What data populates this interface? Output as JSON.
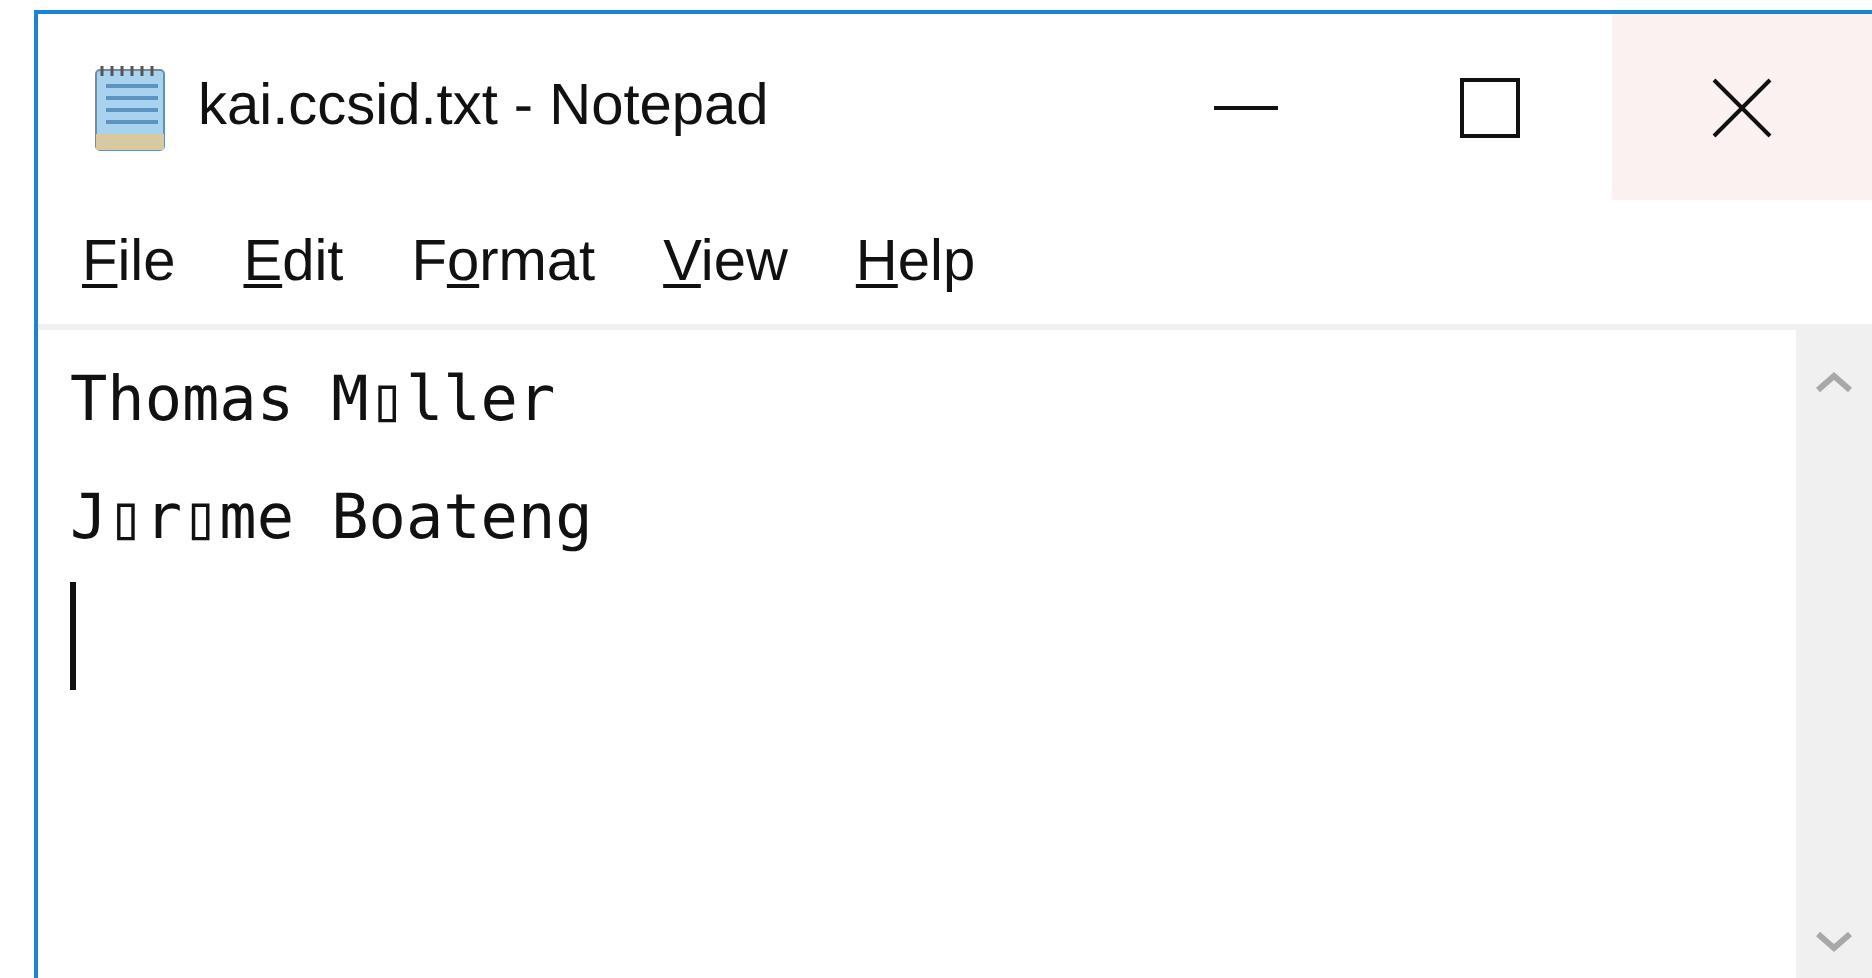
{
  "window": {
    "title": "kai.ccsid.txt - Notepad"
  },
  "menu": [
    {
      "key": "F",
      "after": "ile"
    },
    {
      "key": "E",
      "after": "dit"
    },
    {
      "before": "F",
      "key": "o",
      "after": "rmat"
    },
    {
      "key": "V",
      "after": "iew"
    },
    {
      "key": "H",
      "after": "elp"
    }
  ],
  "editor": {
    "lines": [
      "Thomas M▯ller",
      "J▯r▯me Boateng"
    ]
  }
}
